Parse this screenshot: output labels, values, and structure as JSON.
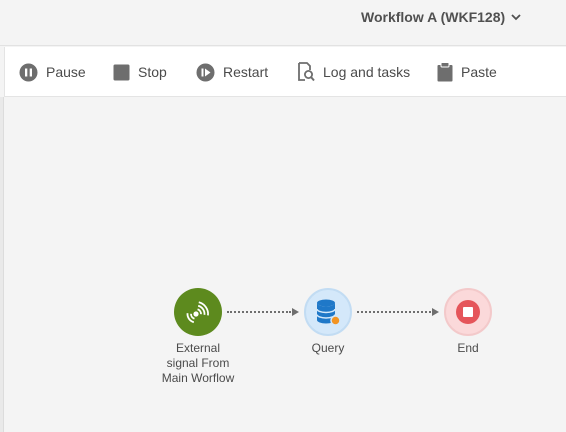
{
  "header": {
    "workflow_title": "Workflow A (WKF128)"
  },
  "toolbar": {
    "pause_label": "Pause",
    "stop_label": "Stop",
    "restart_label": "Restart",
    "log_label": "Log and tasks",
    "paste_label": "Paste"
  },
  "workflow": {
    "nodes": [
      {
        "label": "External\nsignal From\nMain Worflow",
        "icon": "signal-icon",
        "color": "#5d8a1e"
      },
      {
        "label": "Query",
        "icon": "database-icon",
        "color": "#1f78c8"
      },
      {
        "label": "End",
        "icon": "stop-icon",
        "color": "#e5555a"
      }
    ]
  },
  "colors": {
    "accent_green": "#5d8a1e",
    "accent_blue": "#1f78c8",
    "accent_red": "#e5555a",
    "badge_orange": "#f29423"
  }
}
